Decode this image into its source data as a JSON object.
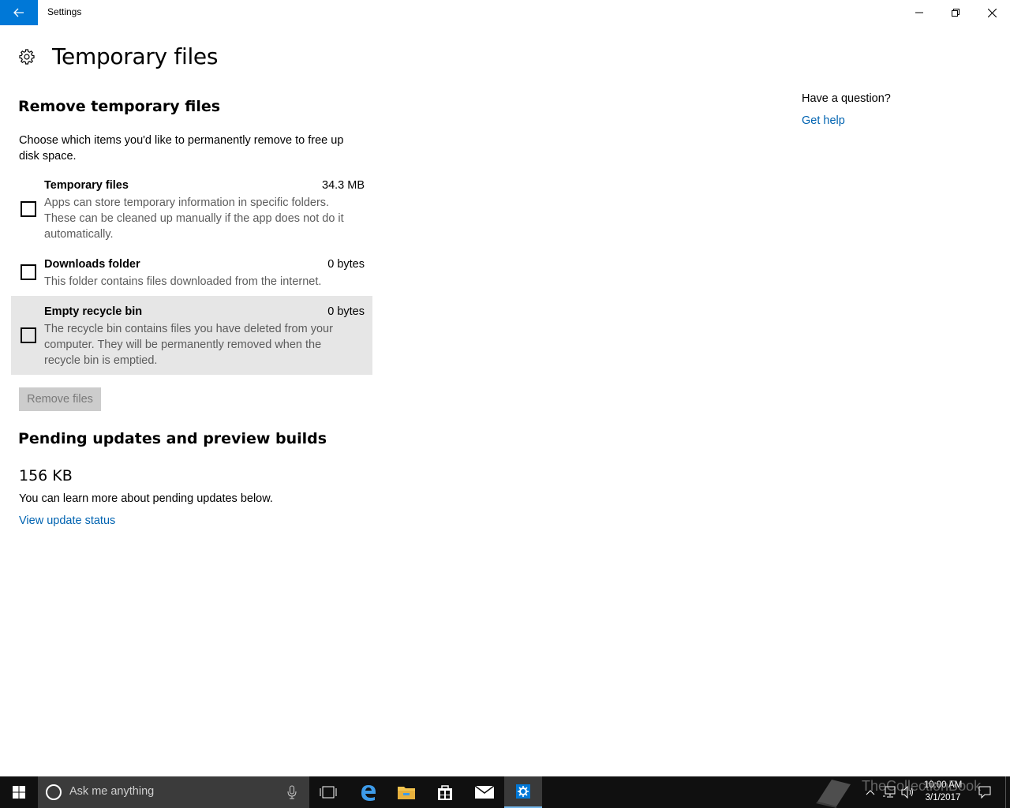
{
  "window": {
    "app_title": "Settings",
    "accent_color": "#0078d7"
  },
  "page": {
    "title": "Temporary files"
  },
  "remove_section": {
    "heading": "Remove temporary files",
    "description": "Choose which items you'd like to permanently remove to free up disk space.",
    "items": [
      {
        "name": "Temporary files",
        "size": "34.3 MB",
        "description": "Apps can store temporary information in specific folders. These can be cleaned up manually if the app does not do it automatically.",
        "checked": false
      },
      {
        "name": "Downloads folder",
        "size": "0 bytes",
        "description": "This folder contains files downloaded from the internet.",
        "checked": false
      },
      {
        "name": "Empty recycle bin",
        "size": "0 bytes",
        "description": "The recycle bin contains files you have deleted from your computer. They will be permanently removed when the recycle bin is emptied.",
        "checked": false
      }
    ],
    "remove_button": "Remove files"
  },
  "pending_section": {
    "heading": "Pending updates and preview builds",
    "size": "156 KB",
    "description": "You can learn more about pending updates below.",
    "link": "View update status"
  },
  "help": {
    "question": "Have a question?",
    "link": "Get help"
  },
  "taskbar": {
    "search_placeholder": "Ask me anything",
    "icons": [
      "start-icon",
      "cortana-icon",
      "microphone-icon",
      "task-view-icon",
      "edge-icon",
      "file-explorer-icon",
      "store-icon",
      "mail-icon",
      "settings-icon"
    ],
    "tray_icons": [
      "chevron-up-icon",
      "network-icon",
      "volume-icon",
      "notifications-icon"
    ],
    "time": "10:00 AM",
    "date": "3/1/2017"
  },
  "watermark": {
    "text": "TheCollectionBook"
  }
}
